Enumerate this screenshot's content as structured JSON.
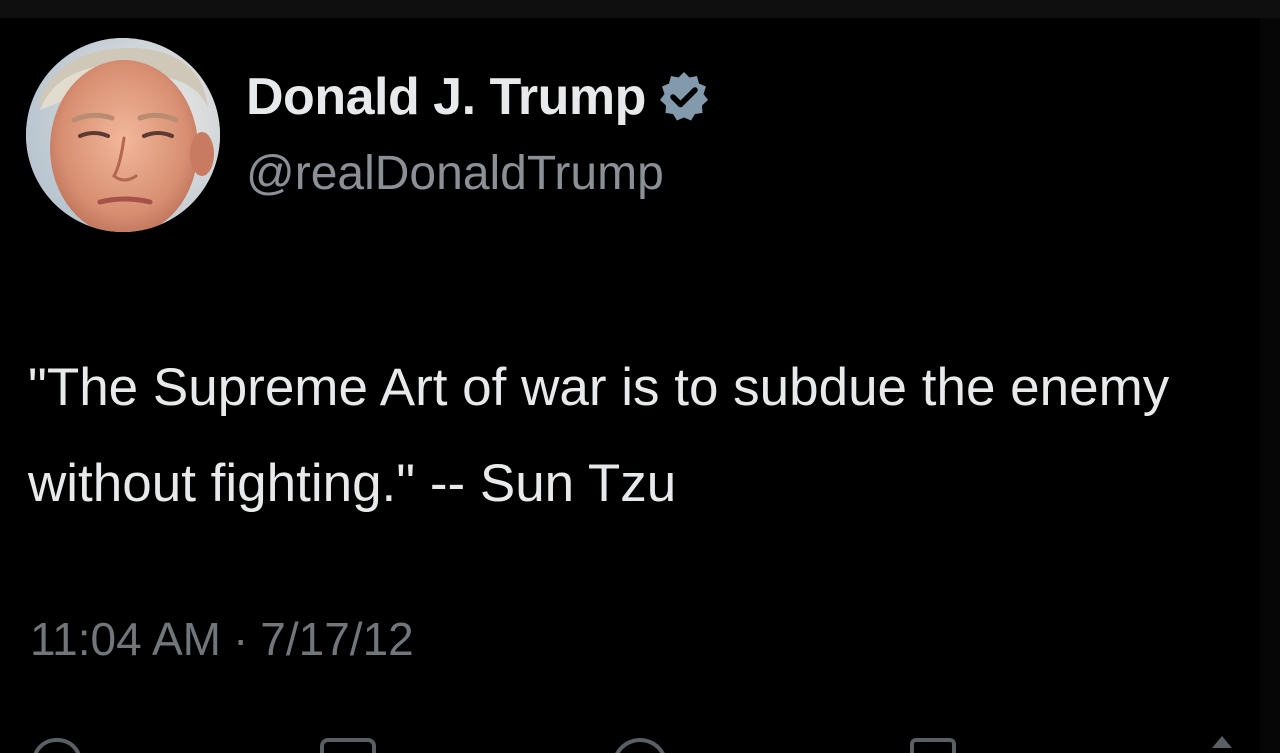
{
  "tweet": {
    "author": {
      "display_name": "Donald J. Trump",
      "handle": "@realDonaldTrump",
      "verified": true
    },
    "text": "\"The Supreme Art of war is to subdue the enemy without fighting.\" -- Sun Tzu",
    "time": "11:04 AM",
    "separator": "·",
    "date": "7/17/12"
  },
  "icons": {
    "avatar": "profile-photo",
    "verified": "verified-badge-icon",
    "reply": "reply-icon",
    "retweet": "retweet-icon",
    "like": "heart-icon",
    "bookmark": "bookmark-icon",
    "share": "share-icon"
  },
  "colors": {
    "background": "#000000",
    "primary_text": "#e7e9ea",
    "secondary_text": "#71767b",
    "verified_badge": "#829aab"
  }
}
